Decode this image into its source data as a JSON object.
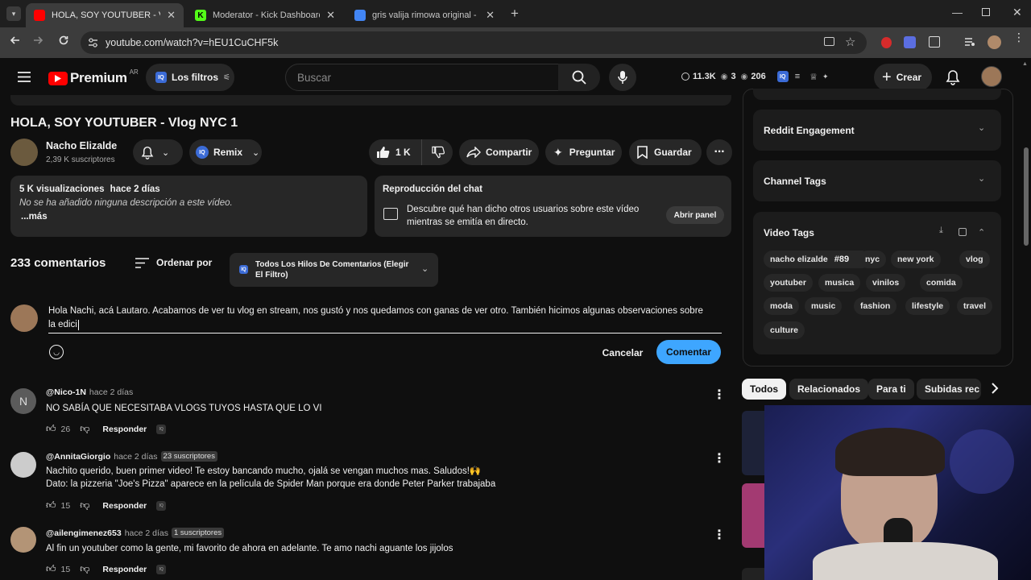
{
  "browser": {
    "tabs": [
      {
        "title": "HOLA, SOY YOUTUBER - Vlog N",
        "color": "#ff0000"
      },
      {
        "title": "Moderator - Kick Dashboard",
        "color": "#53fc18"
      },
      {
        "title": "gris valija rimowa original - Goo",
        "color": "#4285f4"
      }
    ],
    "url": "youtube.com/watch?v=hEU1CuCHF5k"
  },
  "header": {
    "logo": "Premium",
    "region": "AR",
    "filters_label": "Los filtros",
    "search_placeholder": "Buscar",
    "stats": {
      "views": "11.3K",
      "eye": "3",
      "watching": "206"
    },
    "create_label": "Crear"
  },
  "video": {
    "title": "HOLA, SOY YOUTUBER - Vlog NYC 1",
    "channel": "Nacho Elizalde",
    "subscribers": "2,39 K suscriptores",
    "remix_label": "Remix",
    "likes": "1 K",
    "share_label": "Compartir",
    "ask_label": "Preguntar",
    "save_label": "Guardar"
  },
  "description": {
    "views": "5 K visualizaciones",
    "date": "hace 2 días",
    "text": "No se ha añadido ninguna descripción a este vídeo.",
    "more": "...más"
  },
  "chat_replay": {
    "title": "Reproducción del chat",
    "text_line1": "Descubre qué han dicho otros usuarios sobre este vídeo",
    "text_line2": "mientras se emitía en directo.",
    "open_label": "Abrir panel"
  },
  "comments_header": {
    "count": "233 comentarios",
    "sort_label": "Ordenar por",
    "filter_line1": "Todos Los Hilos De Comentarios (Elegir",
    "filter_line2": "El Filtro)"
  },
  "compose": {
    "text_line1": "Hola Nachi, acá Lautaro. Acabamos de ver tu vlog en stream, nos gustó y nos quedamos con ganas de ver otro. También hicimos algunas observaciones sobre",
    "text_line2": "la edici",
    "cancel_label": "Cancelar",
    "submit_label": "Comentar"
  },
  "comments": [
    {
      "user": "@Nico-1N",
      "time": "hace 2 días",
      "badge": "",
      "line1": "NO SABÍA QUE NECESITABA VLOGS TUYOS HASTA QUE LO VI",
      "line2": "",
      "likes": "26",
      "reply": "Responder",
      "avatar_letter": "N"
    },
    {
      "user": "@AnnitaGiorgio",
      "time": "hace 2 días",
      "badge": "23 suscriptores",
      "line1": "Nachito querido, buen primer video! Te estoy bancando mucho, ojalá se vengan muchos mas. Saludos!🙌",
      "line2": "Dato: la pizzeria \"Joe's Pizza\" aparece en la película de Spider Man porque era donde Peter Parker trabajaba",
      "likes": "15",
      "reply": "Responder",
      "avatar_letter": ""
    },
    {
      "user": "@ailengimenez653",
      "time": "hace 2 días",
      "badge": "1 suscriptores",
      "line1": "Al fin un youtuber como la gente, mi favorito de ahora en adelante. Te amo nachi aguante los jijolos",
      "line2": "",
      "likes": "15",
      "reply": "Responder",
      "avatar_letter": ""
    }
  ],
  "sidebar": {
    "panels": [
      "Reddit Engagement",
      "Channel Tags"
    ],
    "video_tags_title": "Video Tags",
    "tags": [
      [
        "nacho elizalde",
        "#89",
        "nyc",
        "new york",
        "vlog"
      ],
      [
        "youtuber",
        "musica",
        "vinilos",
        "comida"
      ],
      [
        "moda",
        "music",
        "fashion",
        "lifestyle",
        "travel"
      ],
      [
        "culture"
      ]
    ],
    "filter_chips": [
      "Todos",
      "Relacionados",
      "Para ti",
      "Subidas rec"
    ]
  }
}
